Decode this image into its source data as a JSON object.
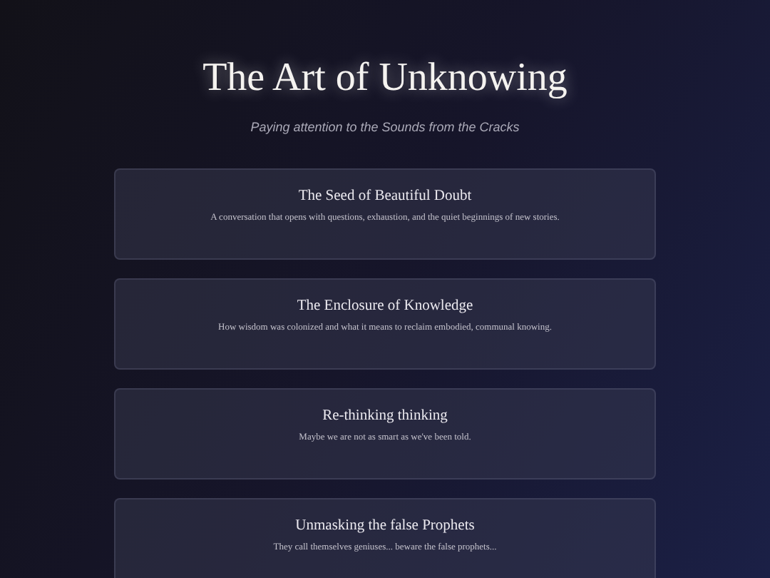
{
  "header": {
    "title": "The Art of Unknowing",
    "subtitle": "Paying attention to the Sounds from the Cracks"
  },
  "cards": [
    {
      "title": "The Seed of Beautiful Doubt",
      "description": "A conversation that opens with questions, exhaustion, and the quiet beginnings of new stories."
    },
    {
      "title": "The Enclosure of Knowledge",
      "description": "How wisdom was colonized and what it means to reclaim embodied, communal knowing."
    },
    {
      "title": "Re-thinking thinking",
      "description": "Maybe we are not as smart as we've been told."
    },
    {
      "title": "Unmasking the false Prophets",
      "description": "They call themselves geniuses... beware the false prophets..."
    }
  ]
}
